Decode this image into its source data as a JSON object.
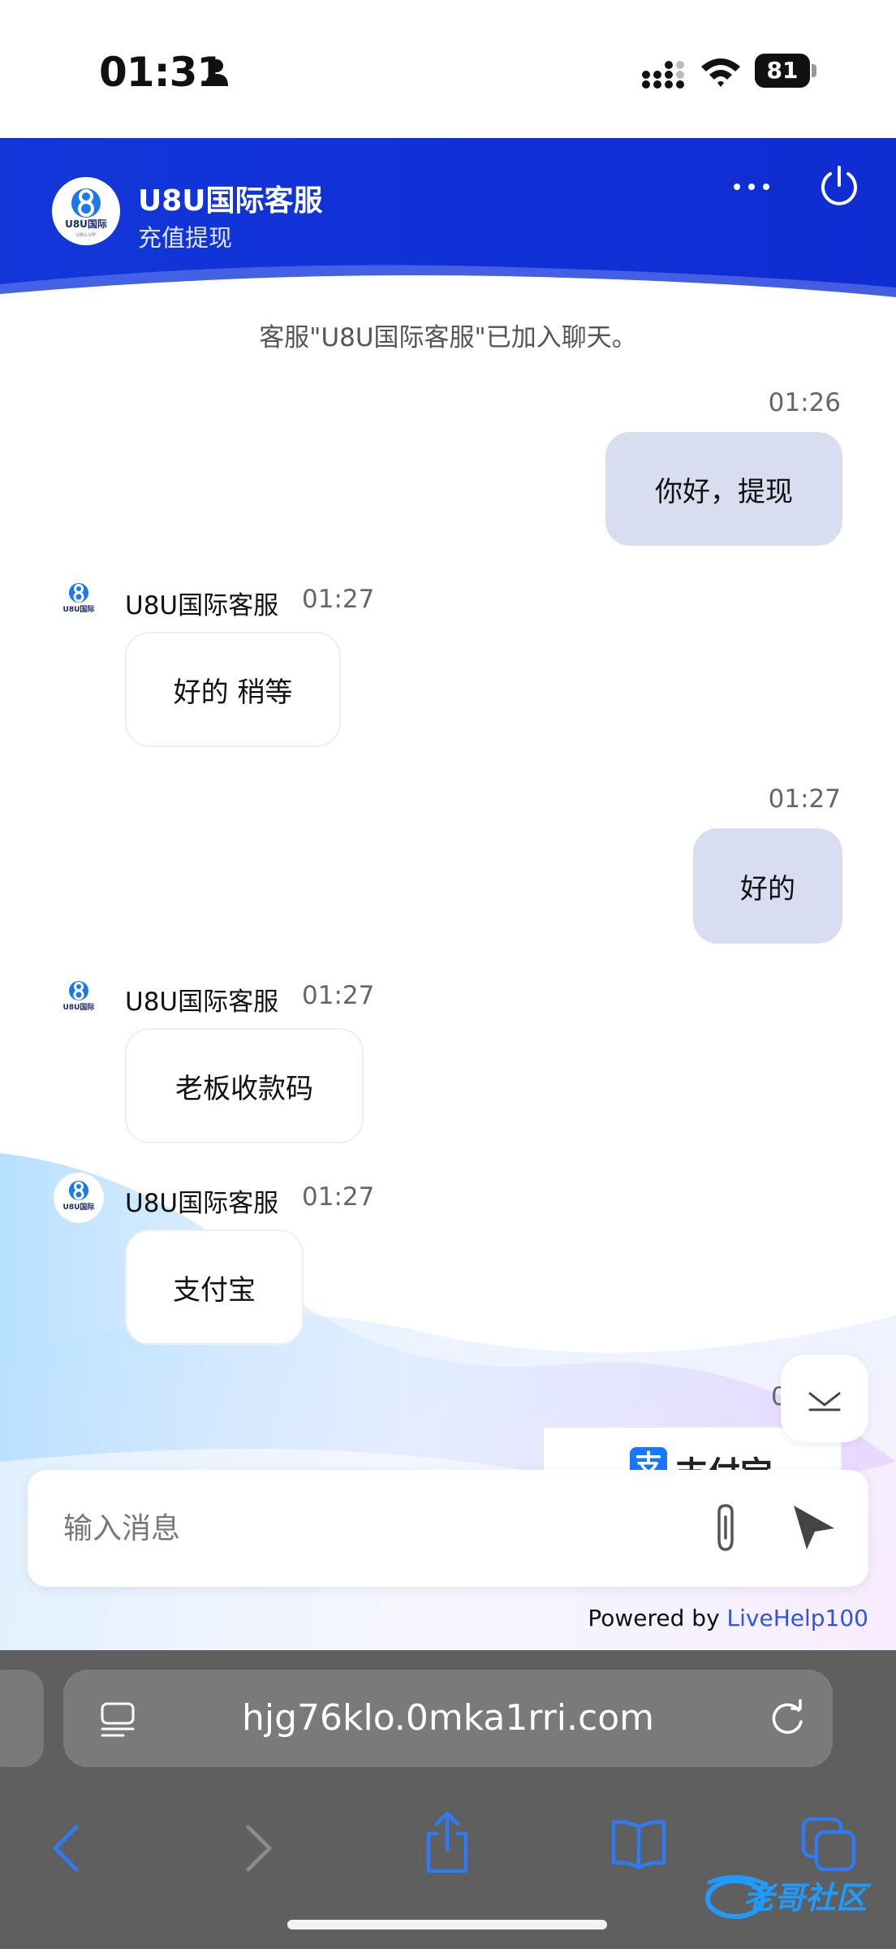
{
  "status_bar": {
    "time": "01:31",
    "battery": "81"
  },
  "header": {
    "title": "U8U国际客服",
    "subtitle": "充值提现",
    "logo_text": "U8U国际",
    "logo_sub": "U8U.VIP",
    "colors": {
      "primary": "#1237d9"
    }
  },
  "chat": {
    "system_message": "客服\"U8U国际客服\"已加入聊天。",
    "messages": [
      {
        "from": "user",
        "time": "01:26",
        "text": "你好，提现"
      },
      {
        "from": "agent",
        "name": "U8U国际客服",
        "time": "01:27",
        "text": "好的 稍等"
      },
      {
        "from": "user",
        "time": "01:27",
        "text": "好的"
      },
      {
        "from": "agent",
        "name": "U8U国际客服",
        "time": "01:27",
        "text": "老板收款码"
      },
      {
        "from": "agent",
        "name": "U8U国际客服",
        "time": "01:27",
        "text": "支付宝"
      }
    ],
    "partial_time": "0",
    "partial_card": {
      "logo": "支",
      "text": "支付宝"
    }
  },
  "input": {
    "placeholder": "输入消息"
  },
  "footer": {
    "powered_prefix": "Powered by ",
    "powered_link": "LiveHelp100"
  },
  "browser": {
    "url": "hjg76klo.0mka1rri.com"
  },
  "watermark": {
    "text": "老哥社区"
  }
}
